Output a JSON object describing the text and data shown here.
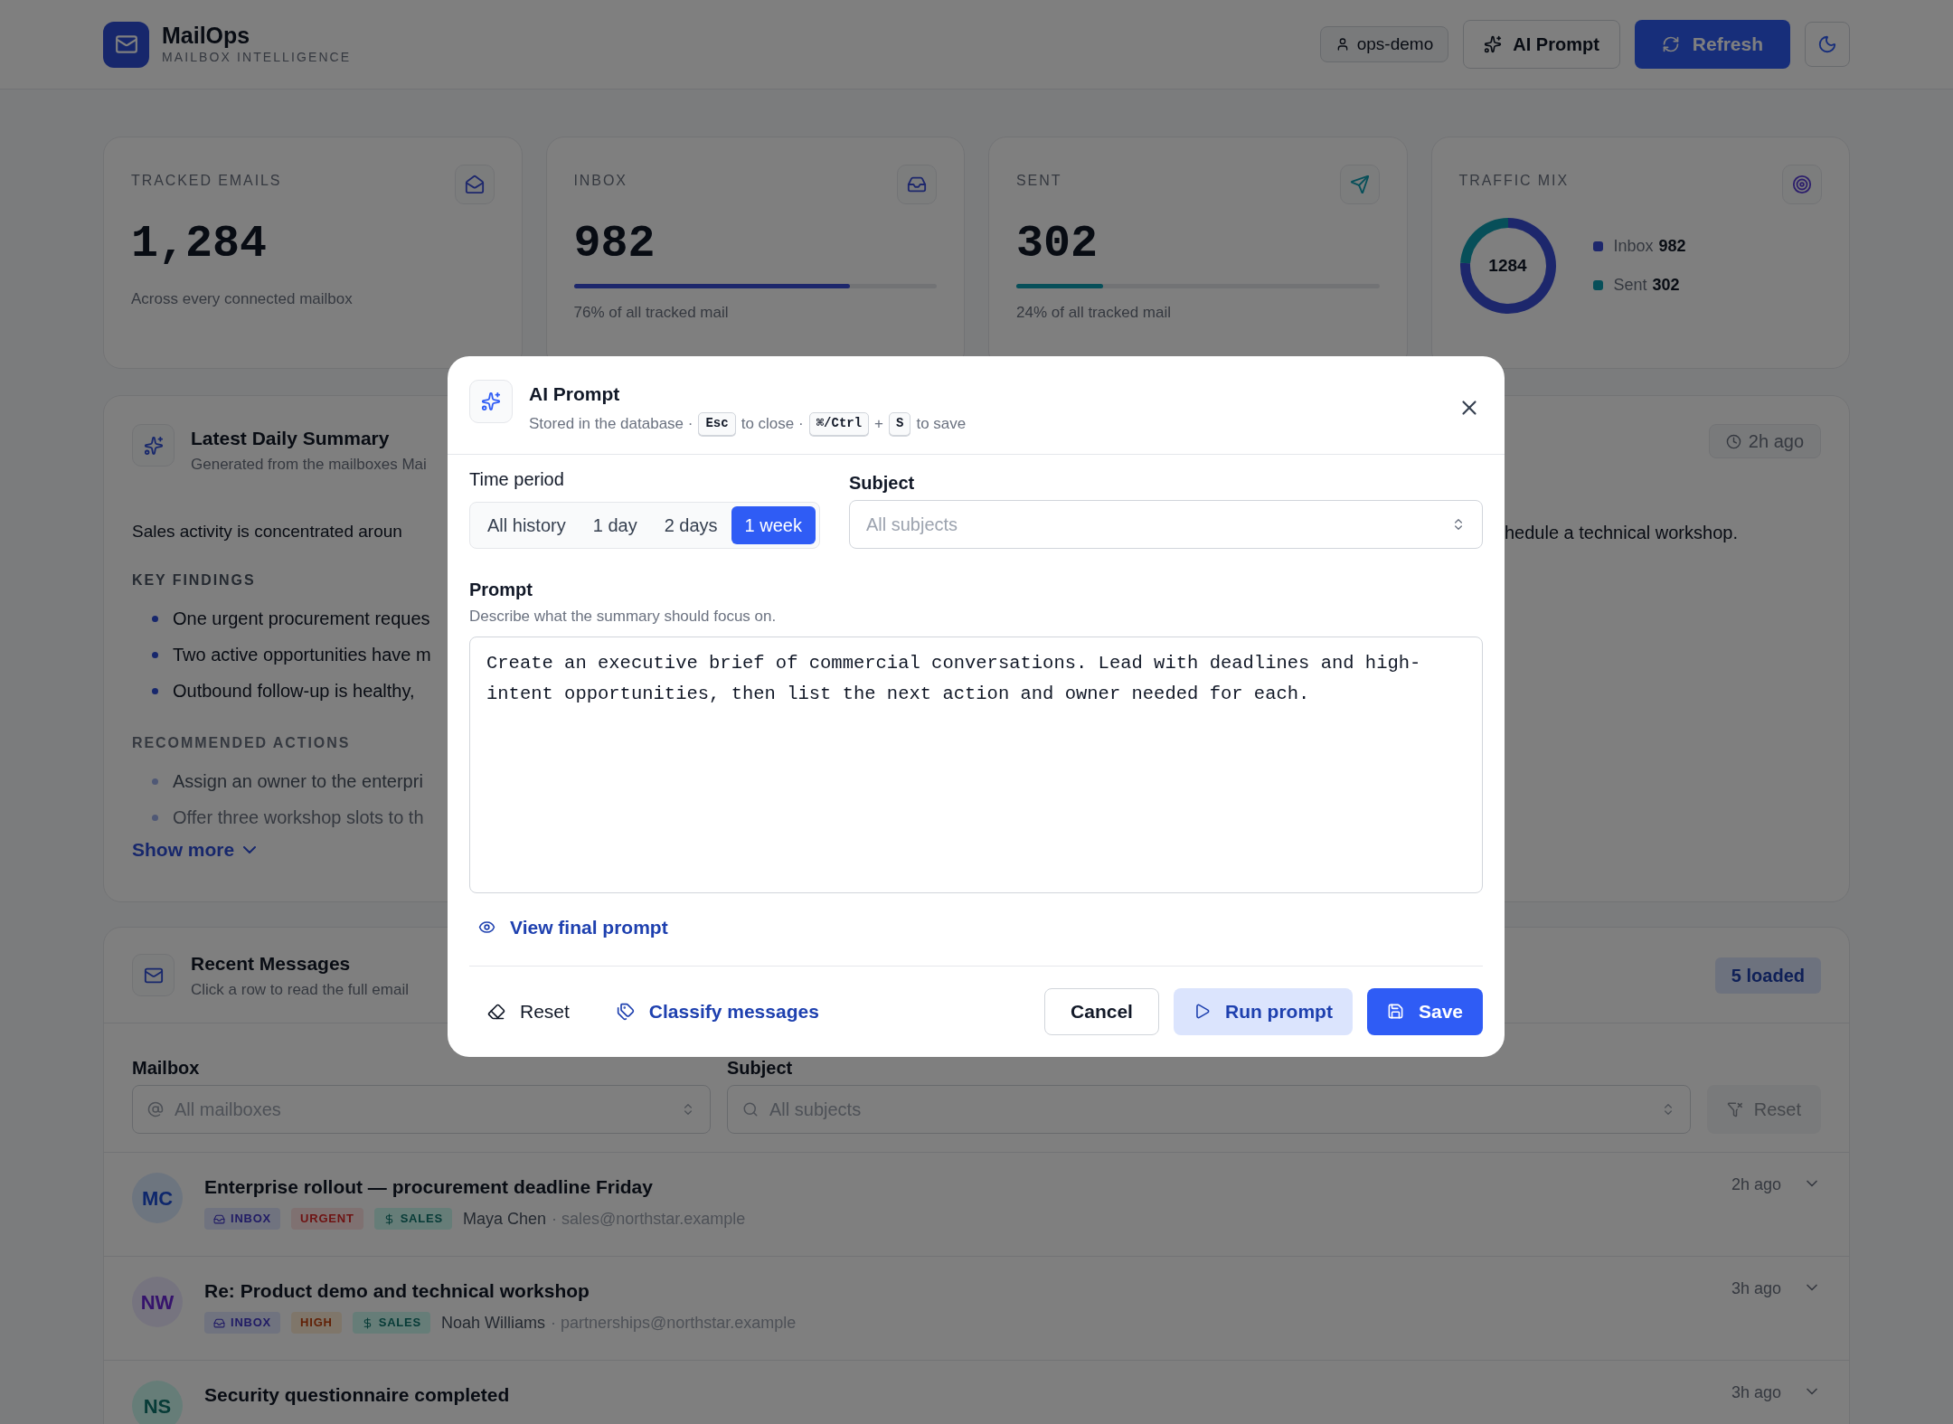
{
  "header": {
    "brand": "MailOps",
    "tagline": "MAILBOX INTELLIGENCE",
    "user": "ops-demo",
    "ai_button": "AI Prompt",
    "refresh_button": "Refresh"
  },
  "stats": [
    {
      "kind": "total",
      "label": "TRACKED EMAILS",
      "value": "1,284",
      "caption": "Across every connected mailbox"
    },
    {
      "kind": "inbox",
      "label": "INBOX",
      "value": "982",
      "caption": "76% of all tracked mail",
      "level": 0.76
    },
    {
      "kind": "sent",
      "label": "SENT",
      "value": "302",
      "caption": "24% of all tracked mail",
      "level": 0.24
    }
  ],
  "traffic_mix": {
    "label": "TRAFFIC MIX",
    "total": "1284",
    "legend_values": [
      "982",
      "302"
    ],
    "chart_data": {
      "type": "donut",
      "categories": [
        "Inbox",
        "Sent"
      ],
      "values": [
        76,
        24
      ]
    }
  },
  "summary": {
    "title": "Latest Daily Summary",
    "subtitle": "Generated from the mailboxes Mai",
    "time": "2h ago",
    "intro_left": "Sales activity is concentrated aroun",
    "intro_right": "hedule a technical workshop.",
    "sections": [
      {
        "heading": "KEY FINDINGS",
        "faded": false,
        "items": [
          "One urgent procurement reques",
          "Two active opportunities have m",
          "Outbound follow-up is healthy,"
        ]
      },
      {
        "heading": "RECOMMENDED ACTIONS",
        "faded": true,
        "items": [
          "Assign an owner to the enterpri",
          "Offer three workshop slots to th"
        ]
      }
    ],
    "show_more": "Show more"
  },
  "messages_panel": {
    "title": "Recent Messages",
    "subtitle": "Click a row to read the full email",
    "count": "5 loaded",
    "filters": {
      "mailbox_label": "Mailbox",
      "mailbox_placeholder": "All mailboxes",
      "subject_label": "Subject",
      "subject_placeholder": "All subjects",
      "reset": "Reset",
      "reset_disabled": true
    },
    "messages": [
      {
        "initials": "MC",
        "title": "Enterprise rollout — procurement deadline Friday",
        "time": "2h ago",
        "sender": "Maya Chen",
        "email": "· sales@northstar.example",
        "tags": [
          {
            "kind": "inbox",
            "label": "INBOX"
          },
          {
            "kind": "urgent",
            "label": "URGENT"
          },
          {
            "kind": "sales",
            "label": "SALES"
          }
        ]
      },
      {
        "initials": "NW",
        "title": "Re: Product demo and technical workshop",
        "time": "3h ago",
        "sender": "Noah Williams",
        "email": "· partnerships@northstar.example",
        "tags": [
          {
            "kind": "inbox",
            "label": "INBOX"
          },
          {
            "kind": "high",
            "label": "HIGH"
          },
          {
            "kind": "sales",
            "label": "SALES"
          }
        ]
      },
      {
        "initials": "NS",
        "title": "Security questionnaire completed",
        "time": "3h ago"
      }
    ]
  },
  "modal": {
    "title": "AI Prompt",
    "subtitle_parts": [
      {
        "kind": "text",
        "text": "Stored in the database ·"
      },
      {
        "kind": "key",
        "text": "Esc"
      },
      {
        "kind": "text",
        "text": "to close ·"
      },
      {
        "kind": "key",
        "text": "⌘/Ctrl"
      },
      {
        "kind": "text",
        "text": "+"
      },
      {
        "kind": "key",
        "text": "S"
      },
      {
        "kind": "text",
        "text": "to save"
      }
    ],
    "time_period_label": "Time period",
    "periods": [
      {
        "label": "All history",
        "selected": false
      },
      {
        "label": "1 day",
        "selected": false
      },
      {
        "label": "2 days",
        "selected": false
      },
      {
        "label": "1 week",
        "selected": true
      }
    ],
    "subject_label": "Subject",
    "subject_placeholder": "All subjects",
    "prompt_label": "Prompt",
    "prompt_hint": "Describe what the summary should focus on.",
    "prompt": "Create an executive brief of commercial conversations. Lead with deadlines and high-intent opportunities, then list the next action and owner needed for each.",
    "view_final": "View final prompt",
    "reset": "Reset",
    "classify": "Classify messages",
    "cancel": "Cancel",
    "run": "Run prompt",
    "save": "Save"
  }
}
